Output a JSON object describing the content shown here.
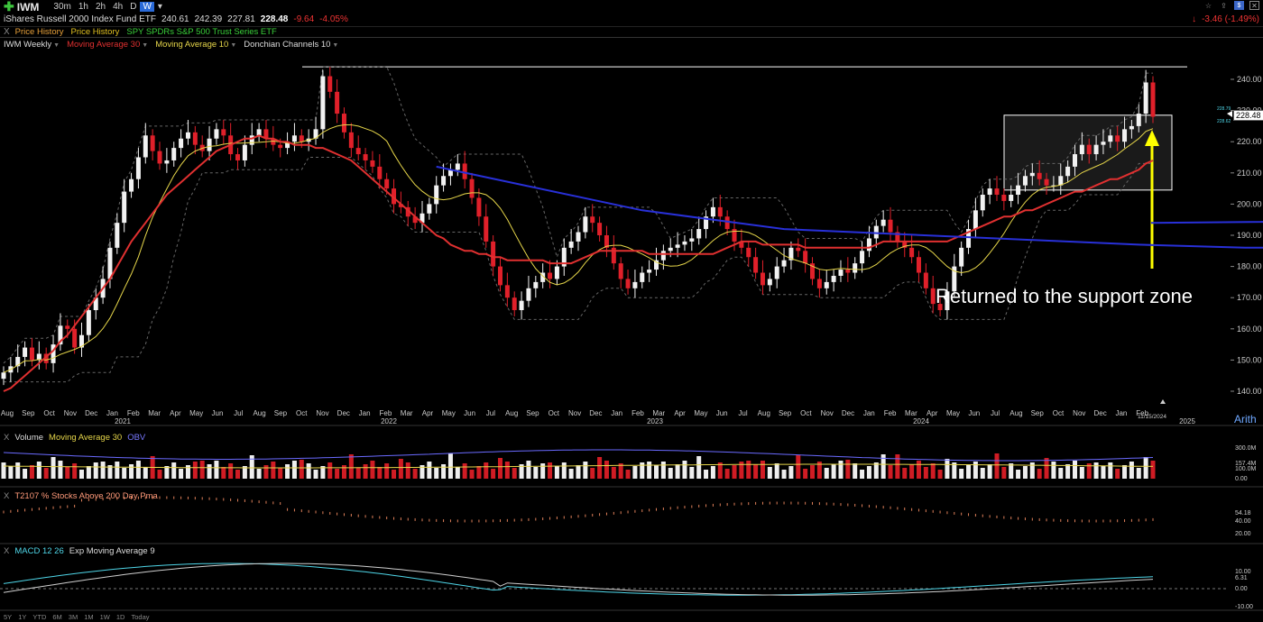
{
  "toolbar": {
    "symbol": "IWM",
    "timeframes": [
      "30m",
      "1h",
      "2h",
      "4h",
      "D",
      "W"
    ],
    "active_timeframe": "W",
    "right_change": "-3.46 (-1.49%)"
  },
  "quote": {
    "name": "iShares Russell 2000 Index Fund ETF",
    "open": "240.61",
    "high": "242.39",
    "low": "227.81",
    "last": "228.48",
    "change": "-9.64",
    "change_pct": "-4.05%"
  },
  "overlays": [
    {
      "label": "Price History",
      "color": "#e8a13a"
    },
    {
      "label": "Price History",
      "color": "#e0c020"
    },
    {
      "label": "SPY SPDRs S&P 500 Trust Series ETF",
      "color": "#3ad03a"
    }
  ],
  "studies_bar": [
    {
      "label": "IWM Weekly",
      "color": "#dddddd"
    },
    {
      "label": "Moving Average 30",
      "color": "#e03030"
    },
    {
      "label": "Moving Average 10",
      "color": "#e6d64a"
    },
    {
      "label": "Donchian Channels 10",
      "color": "#dddddd"
    }
  ],
  "price_axis": {
    "ticks": [
      "240.00",
      "230.00",
      "220.00",
      "210.00",
      "200.00",
      "190.00",
      "180.00",
      "170.00",
      "160.00",
      "150.00",
      "140.00"
    ],
    "current_price": "228.48",
    "small_upper": "228.79",
    "small_lower": "228.62"
  },
  "time_axis": {
    "months": [
      "Aug",
      "Sep",
      "Oct",
      "Nov",
      "Dec",
      "Jan",
      "Feb",
      "Mar",
      "Apr",
      "May",
      "Jun",
      "Jul",
      "Aug",
      "Sep",
      "Oct",
      "Nov",
      "Dec",
      "Jan",
      "Feb",
      "Mar",
      "Apr",
      "May",
      "Jun",
      "Jul",
      "Aug",
      "Sep",
      "Oct",
      "Nov",
      "Dec",
      "Jan",
      "Feb",
      "Mar",
      "Apr",
      "May",
      "Jun",
      "Jul",
      "Aug",
      "Sep",
      "Oct",
      "Nov",
      "Dec",
      "Jan",
      "Feb",
      "Mar",
      "Apr",
      "May",
      "Jun",
      "Jul",
      "Aug",
      "Sep",
      "Oct",
      "Nov",
      "Dec",
      "Jan",
      "Feb"
    ],
    "years": [
      "2021",
      "2022",
      "2023",
      "2024",
      "2025"
    ],
    "date_flag": "11/15/2024"
  },
  "annotation": "Returned to the support zone",
  "scale_mode": "Arith",
  "volume_pane": {
    "labels": [
      {
        "label": "Volume",
        "color": "#dddddd"
      },
      {
        "label": "Moving Average 30",
        "color": "#e6d64a"
      },
      {
        "label": "OBV",
        "color": "#7878ff"
      }
    ],
    "ticks": [
      "300.0M",
      "157.4M",
      "100.0M",
      "0.00"
    ]
  },
  "t2107_pane": {
    "label": "T2107 % Stocks Above 200 Day Pma",
    "color": "#ff9a7a",
    "ticks": [
      "54.18",
      "40.00",
      "20.00"
    ]
  },
  "macd_pane": {
    "labels": [
      {
        "label": "MACD 12 26",
        "color": "#4fd6e8"
      },
      {
        "label": "Exp Moving Average 9",
        "color": "#dddddd"
      }
    ],
    "ticks": [
      "10.00",
      "6.31",
      "0.00",
      "-10.00"
    ]
  },
  "periods": [
    "5Y",
    "1Y",
    "YTD",
    "6M",
    "3M",
    "1M",
    "1W",
    "1D",
    "Today"
  ],
  "chart_data": {
    "type": "candlestick",
    "ylim": [
      137,
      247
    ],
    "resistance_level": 244,
    "support_zone": [
      204.5,
      228.5
    ],
    "weekly_close": [
      146,
      148,
      151,
      154,
      150,
      152,
      149,
      155,
      161,
      160,
      154,
      158,
      166,
      170,
      176,
      186,
      194,
      204,
      208,
      215,
      222,
      217,
      213,
      214,
      218,
      221,
      223,
      219,
      217,
      221,
      224,
      222,
      216,
      214,
      219,
      222,
      224,
      221,
      219,
      218,
      220,
      222,
      220,
      221,
      224,
      241,
      236,
      229,
      223,
      218,
      216,
      214,
      212,
      208,
      205,
      200,
      199,
      196,
      194,
      197,
      200,
      206,
      209,
      211,
      213,
      208,
      202,
      196,
      188,
      180,
      174,
      170,
      166,
      169,
      173,
      175,
      178,
      176,
      180,
      186,
      188,
      191,
      196,
      194,
      190,
      186,
      181,
      176,
      173,
      175,
      178,
      179,
      182,
      185,
      186,
      187,
      188,
      189,
      192,
      196,
      199,
      196,
      192,
      188,
      186,
      183,
      178,
      174,
      176,
      180,
      182,
      186,
      185,
      181,
      176,
      173,
      175,
      177,
      179,
      178,
      181,
      185,
      189,
      193,
      195,
      191,
      188,
      186,
      183,
      178,
      173,
      168,
      166,
      172,
      180,
      186,
      192,
      198,
      203,
      205,
      203,
      201,
      203,
      206,
      209,
      210,
      208,
      206,
      206,
      209,
      212,
      216,
      219,
      216,
      219,
      220,
      222,
      220,
      224,
      225,
      229,
      239,
      228
    ],
    "sma30": [
      140,
      141,
      143,
      145,
      147,
      149,
      151,
      153,
      156,
      158,
      161,
      164,
      167,
      170,
      173,
      176,
      180,
      184,
      188,
      191,
      194,
      197,
      200,
      203,
      205,
      207,
      209,
      211,
      213,
      215,
      217,
      218,
      219,
      220,
      221,
      221,
      222,
      221,
      221,
      220,
      220,
      219,
      219,
      219,
      218,
      218,
      217,
      216,
      215,
      214,
      212,
      210,
      208,
      206,
      204,
      202,
      200,
      198,
      196,
      194,
      192,
      190,
      189,
      187,
      186,
      185,
      185,
      184,
      184,
      183,
      183,
      182,
      182,
      182,
      182,
      182,
      182,
      181,
      181,
      181,
      181,
      182,
      183,
      184,
      185,
      185,
      185,
      185,
      185,
      185,
      185,
      184,
      184,
      184,
      184,
      184,
      184,
      184,
      184,
      184,
      184,
      185,
      186,
      187,
      188,
      188,
      188,
      187,
      187,
      187,
      187,
      187,
      187,
      186,
      186,
      186,
      186,
      186,
      186,
      186,
      186,
      186,
      186,
      187,
      188,
      188,
      188,
      188,
      188,
      188,
      188,
      188,
      188,
      188,
      189,
      190,
      191,
      192,
      193,
      194,
      195,
      196,
      196,
      197,
      198,
      198,
      199,
      200,
      201,
      202,
      203,
      204,
      204,
      205,
      206,
      207,
      208,
      208,
      209,
      210,
      211,
      213,
      214
    ],
    "blue_ma": [
      [
        0,
        0
      ],
      [
        61,
        212
      ],
      [
        90,
        198
      ],
      [
        110,
        192
      ],
      [
        140,
        189
      ],
      [
        160,
        187
      ],
      [
        175,
        186
      ],
      [
        190,
        186
      ],
      [
        210,
        187
      ],
      [
        240,
        188
      ],
      [
        250,
        191
      ],
      [
        262,
        196
      ]
    ]
  }
}
